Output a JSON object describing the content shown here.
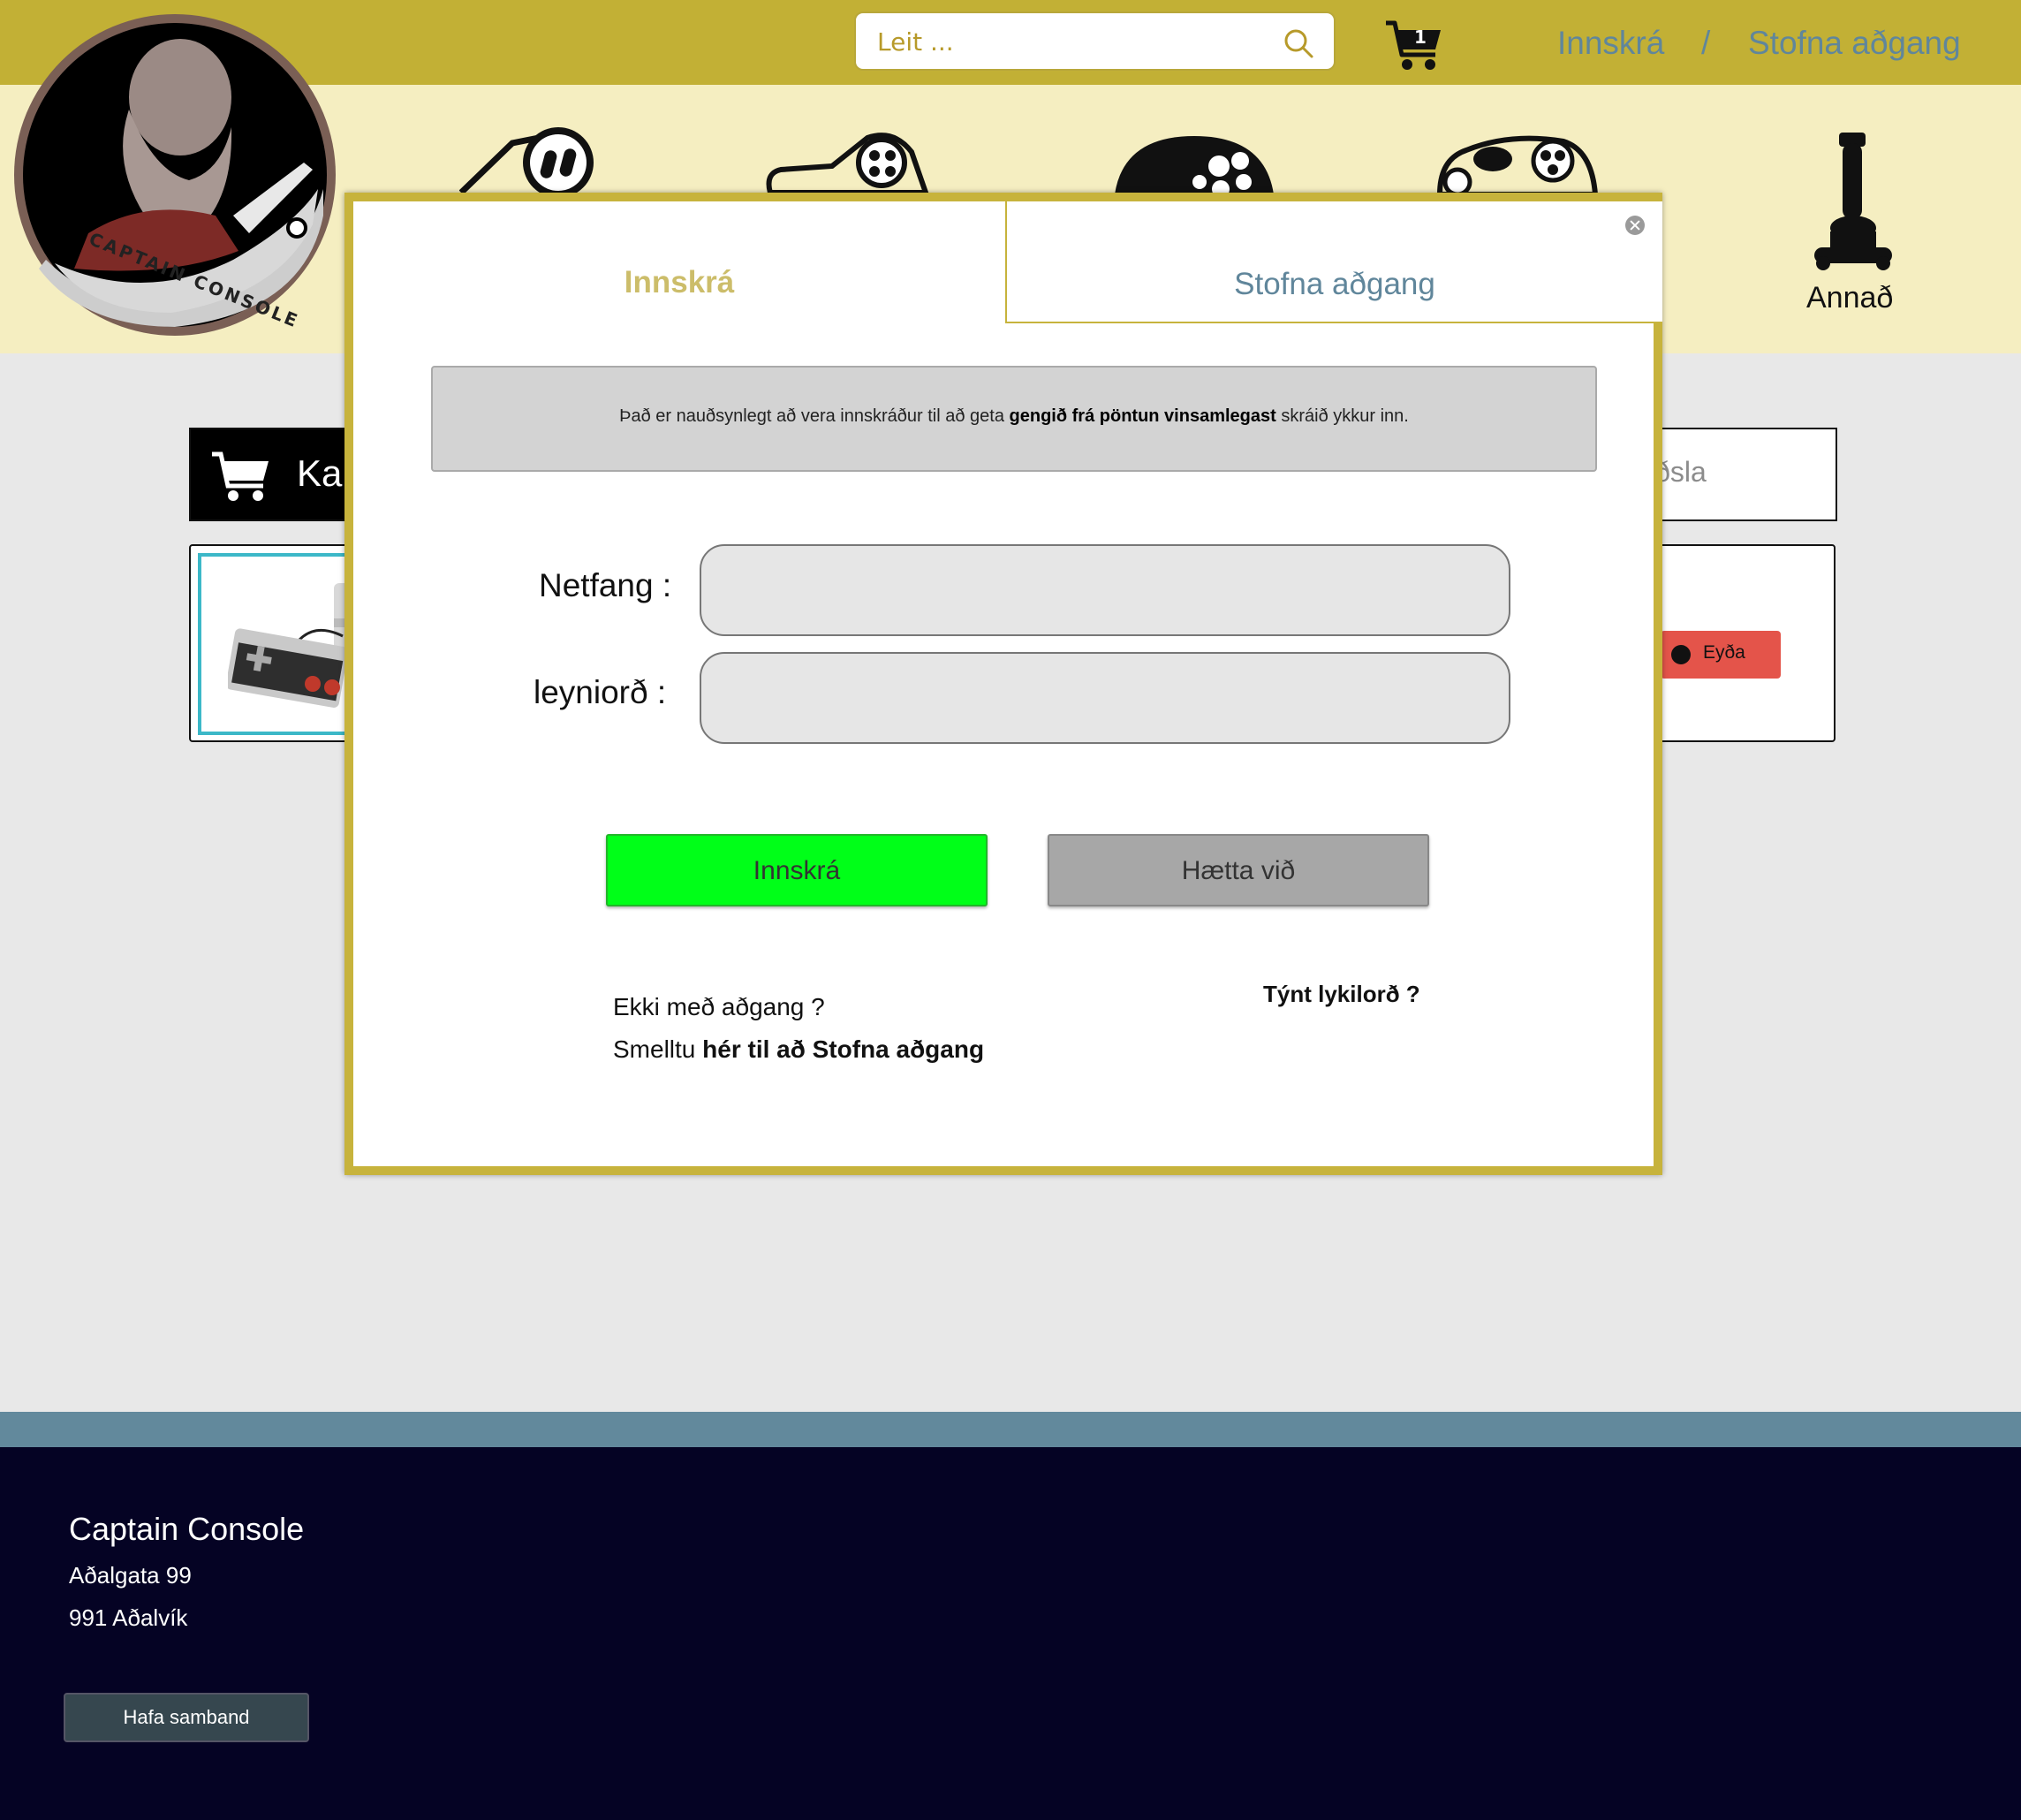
{
  "header": {
    "search_placeholder": "Leit ...",
    "cart_count": "1",
    "login_link": "Innskrá",
    "separator": "/",
    "signup_link": "Stofna aðgang"
  },
  "logo": {
    "text": "CAPTAIN CONSOLE"
  },
  "categories": {
    "other_label": "Annað"
  },
  "cart_page": {
    "heading_partial": "Kar",
    "right_partial": "iðsla",
    "delete_label": "Eyða"
  },
  "login_modal": {
    "tab_login": "Innskrá",
    "tab_signup": "Stofna aðgang",
    "notice_pre": "Það er nauðsynlegt að vera innskráður til að geta ",
    "notice_bold": "gengið frá pöntun vinsamlegast",
    "notice_post": " skráið ykkur inn.",
    "email_label": "Netfang :",
    "password_label": "leyniorð :",
    "submit_label": "Innskrá",
    "cancel_label": "Hætta við",
    "no_account_line1": "Ekki með aðgang ?",
    "no_account_pre": "Smelltu ",
    "no_account_link": "hér til að Stofna aðgang",
    "forgot_label": "Týnt lykilorð ?"
  },
  "footer": {
    "company": "Captain Console",
    "address_line1": "Aðalgata 99",
    "address_line2": "991 Aðalvík",
    "contact_button": "Hafa samband"
  },
  "colors": {
    "topbar": "#c2b035",
    "category_band": "#f5eec1",
    "link_blue": "#60869b",
    "modal_border": "#c7b33c",
    "login_green": "#00ff18",
    "delete_red": "#e4544a",
    "footer": "#050324"
  }
}
